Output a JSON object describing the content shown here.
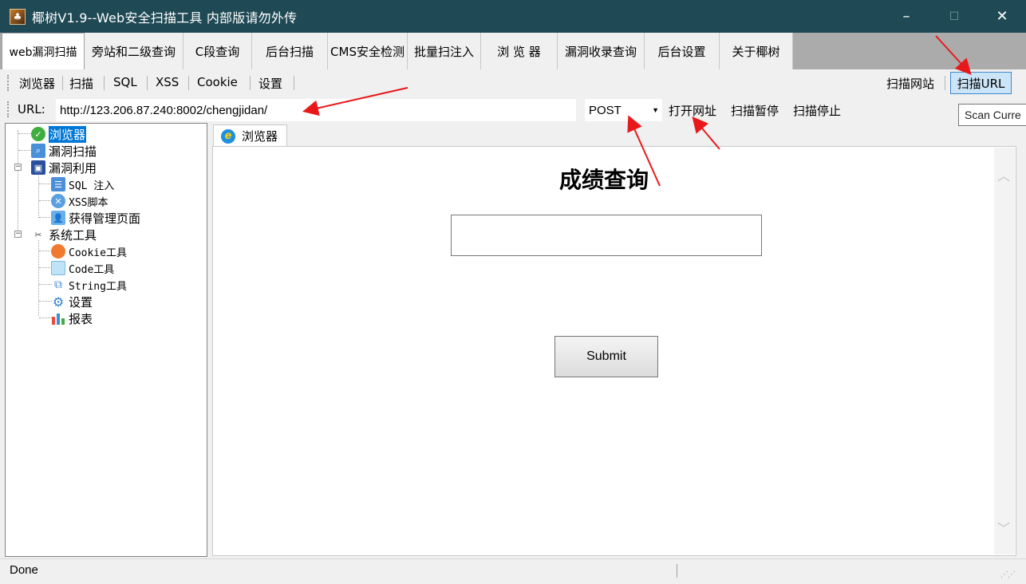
{
  "window": {
    "title": "椰树V1.9--Web安全扫描工具  内部版请勿外传",
    "minimize": "–",
    "maximize": "☐",
    "close": "✕"
  },
  "main_tabs": [
    {
      "label": "web漏洞扫描",
      "active": true
    },
    {
      "label": "旁站和二级查询"
    },
    {
      "label": "C段查询"
    },
    {
      "label": "后台扫描"
    },
    {
      "label": "CMS安全检测"
    },
    {
      "label": "批量扫注入"
    },
    {
      "label": "浏 览 器"
    },
    {
      "label": "漏洞收录查询"
    },
    {
      "label": "后台设置"
    },
    {
      "label": "关于椰树"
    }
  ],
  "toolbar1": {
    "items": [
      "浏览器",
      "扫描",
      "SQL",
      "XSS",
      "Cookie",
      "设置"
    ],
    "scan_site": "扫描网站",
    "scan_url": "扫描URL"
  },
  "toolbar2": {
    "url_label": "URL:",
    "url_value": "http://123.206.87.240:8002/chengjidan/",
    "method": "POST",
    "open_url": "打开网址",
    "pause": "扫描暂停",
    "stop": "扫描停止"
  },
  "tooltip": "Scan Curre",
  "tree": {
    "browser": "浏览器",
    "vuln_scan": "漏洞扫描",
    "vuln_exploit": "漏洞利用",
    "sql_inject": "SQL 注入",
    "xss_script": "XSS脚本",
    "admin_page": "获得管理页面",
    "system_tools": "系统工具",
    "cookie_tool": "Cookie工具",
    "code_tool": "Code工具",
    "string_tool": "String工具",
    "settings": "设置",
    "report": "报表"
  },
  "browser_tab": {
    "label": "浏览器"
  },
  "page": {
    "heading": "成绩查询",
    "submit": "Submit"
  },
  "status": {
    "text": "Done"
  },
  "colors": {
    "titlebar": "#1f4a55",
    "selection": "#0078d7",
    "annotation_arrows": "#e8191b"
  }
}
